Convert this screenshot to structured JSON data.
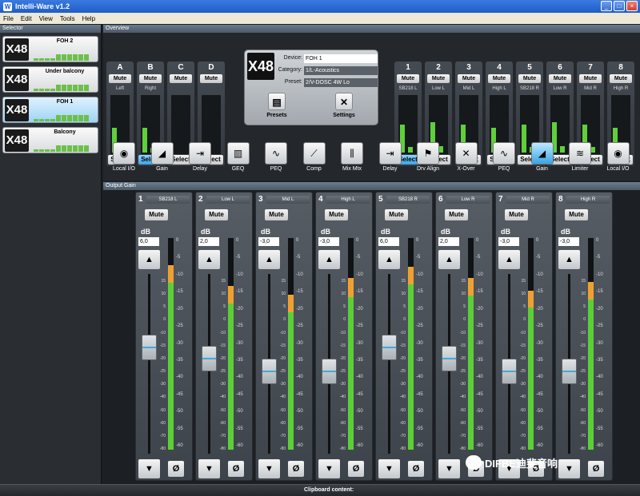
{
  "window": {
    "title": "Intelli-Ware v1.2",
    "icon": "W"
  },
  "menu": [
    "File",
    "Edit",
    "View",
    "Tools",
    "Help"
  ],
  "selector": {
    "title": "Selector",
    "devices": [
      {
        "name": "FOH 2",
        "logo": "X48",
        "active": false
      },
      {
        "name": "Under balcony",
        "logo": "X48",
        "active": false
      },
      {
        "name": "FOH 1",
        "logo": "X48",
        "active": true
      },
      {
        "name": "Balcony",
        "logo": "X48",
        "active": false
      }
    ]
  },
  "overview": {
    "title": "Overview",
    "inputs": [
      {
        "id": "A",
        "mute": "Mute",
        "label": "Left",
        "select": "Select",
        "selected": false,
        "level": 0.45
      },
      {
        "id": "B",
        "mute": "Mute",
        "label": "Right",
        "select": "Select",
        "selected": true,
        "level": 0.45
      },
      {
        "id": "C",
        "mute": "Mute",
        "label": "",
        "select": "Select",
        "selected": false,
        "level": 0
      },
      {
        "id": "D",
        "mute": "Mute",
        "label": "",
        "select": "Select",
        "selected": false,
        "level": 0
      }
    ],
    "outputs": [
      {
        "id": "1",
        "mute": "Mute",
        "label": "SB218 L",
        "select": "Select",
        "selected": true,
        "level": 0.5
      },
      {
        "id": "2",
        "mute": "Mute",
        "label": "Low L",
        "select": "Select",
        "selected": false,
        "level": 0.55
      },
      {
        "id": "3",
        "mute": "Mute",
        "label": "Mid L",
        "select": "Select",
        "selected": false,
        "level": 0.5
      },
      {
        "id": "4",
        "mute": "Mute",
        "label": "High L",
        "select": "Select",
        "selected": false,
        "level": 0.45
      },
      {
        "id": "5",
        "mute": "Mute",
        "label": "SB218 R",
        "select": "Select",
        "selected": false,
        "level": 0.5
      },
      {
        "id": "6",
        "mute": "Mute",
        "label": "Low R",
        "select": "Select",
        "selected": false,
        "level": 0.55
      },
      {
        "id": "7",
        "mute": "Mute",
        "label": "Mid R",
        "select": "Select",
        "selected": false,
        "level": 0.5
      },
      {
        "id": "8",
        "mute": "Mute",
        "label": "High R",
        "select": "Select",
        "selected": false,
        "level": 0.45
      }
    ],
    "comp_label": "Comp",
    "limit_label": "Limit",
    "device": {
      "logo": "X48",
      "device_label": "Device:",
      "device_value": "FOH 1",
      "category_label": "Category:",
      "category_value": "1/L-Acoustics",
      "preset_label": "Preset:",
      "preset_value": "2/V-DOSC 4W Lo",
      "presets_button": "Presets",
      "settings_button": "Settings"
    },
    "chain": [
      {
        "label": "Local I/O",
        "icon": "xlr-icon"
      },
      {
        "label": "Gain",
        "icon": "gain-icon"
      },
      {
        "label": "Delay",
        "icon": "delay-icon"
      },
      {
        "label": "GEQ",
        "icon": "geq-icon"
      },
      {
        "label": "PEQ",
        "icon": "peq-icon"
      },
      {
        "label": "Comp",
        "icon": "comp-icon"
      },
      {
        "label": "Mix Mtx",
        "icon": "mixer-icon"
      },
      {
        "label": "Delay",
        "icon": "delay-icon"
      },
      {
        "label": "Drv Align",
        "icon": "drv-align-icon"
      },
      {
        "label": "X-Over",
        "icon": "xover-icon"
      },
      {
        "label": "PEQ",
        "icon": "peq-icon"
      },
      {
        "label": "Gain",
        "icon": "gain-icon",
        "highlight": true
      },
      {
        "label": "Limiter",
        "icon": "limiter-icon"
      },
      {
        "label": "Local I/O",
        "icon": "xlr-icon"
      }
    ]
  },
  "output_gain": {
    "title": "Output Gain",
    "db_label": "dB",
    "mute": "Mute",
    "phase": "Ø",
    "up": "▲",
    "down": "▼",
    "fader_scale": [
      "15",
      "10",
      "5",
      "0",
      "-10",
      "-15",
      "-20",
      "-25",
      "-30",
      "-40",
      "-50",
      "-60",
      "-70",
      "-80"
    ],
    "meter_scale": [
      "0",
      "-5",
      "-10",
      "-15",
      "-20",
      "-25",
      "-30",
      "-35",
      "-40",
      "-45",
      "-50",
      "-55",
      "-60"
    ],
    "channels": [
      {
        "num": "1",
        "name": "SB218 L",
        "gain": "6,0",
        "fader_frac": 0.62,
        "meter_level": 0.82,
        "peak_frac": 0.79
      },
      {
        "num": "2",
        "name": "Low L",
        "gain": "2,0",
        "fader_frac": 0.55,
        "meter_level": 0.72,
        "peak_frac": 0.69
      },
      {
        "num": "3",
        "name": "Mid L",
        "gain": "-3,0",
        "fader_frac": 0.47,
        "meter_level": 0.68,
        "peak_frac": 0.65
      },
      {
        "num": "4",
        "name": "High L",
        "gain": "-3,0",
        "fader_frac": 0.47,
        "meter_level": 0.76,
        "peak_frac": 0.72
      },
      {
        "num": "5",
        "name": "SB218 R",
        "gain": "6,0",
        "fader_frac": 0.62,
        "meter_level": 0.81,
        "peak_frac": 0.78
      },
      {
        "num": "6",
        "name": "Low R",
        "gain": "2,0",
        "fader_frac": 0.55,
        "meter_level": 0.76,
        "peak_frac": 0.73
      },
      {
        "num": "7",
        "name": "Mid R",
        "gain": "-3,0",
        "fader_frac": 0.47,
        "meter_level": 0.7,
        "peak_frac": 0.67
      },
      {
        "num": "8",
        "name": "High R",
        "gain": "-3,0",
        "fader_frac": 0.47,
        "meter_level": 0.74,
        "peak_frac": 0.71
      }
    ]
  },
  "statusbar": {
    "clipboard": "Clipboard content:"
  },
  "watermark": "DIFBE迪斐音响",
  "colors": {
    "accent": "#3aa3e6",
    "meter_green": "#5ccf38",
    "meter_orange": "#f0a030",
    "titlebar": "#1f5cc8"
  }
}
